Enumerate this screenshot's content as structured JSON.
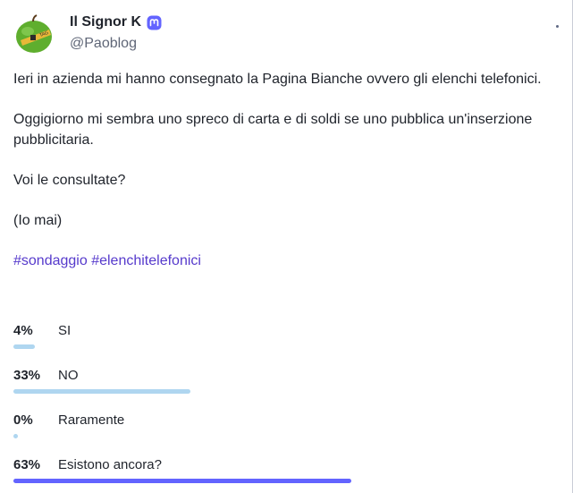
{
  "author": {
    "display_name": "Il Signor K",
    "handle": "@Paoblog",
    "avatar_icon": "green-apple-avatar",
    "badge_icon": "mastodon-icon"
  },
  "post": {
    "paragraphs": [
      "Ieri in azienda mi hanno consegnato la Pagina Bianche ovvero gli elenchi telefonici.",
      "Oggigiorno mi sembra uno spreco di carta e di soldi se uno pubblica un'inserzione pubblicitaria.",
      "Voi le consultate?",
      "(Io mai)"
    ],
    "hashtags": [
      "#sondaggio",
      "#elenchitelefonici"
    ]
  },
  "poll": {
    "options": [
      {
        "percent_label": "4%",
        "label": "SI",
        "percent": 4,
        "leading": false
      },
      {
        "percent_label": "33%",
        "label": "NO",
        "percent": 33,
        "leading": false
      },
      {
        "percent_label": "0%",
        "label": "Raramente",
        "percent": 0,
        "leading": false
      },
      {
        "percent_label": "63%",
        "label": "Esistono ancora?",
        "percent": 63,
        "leading": true
      }
    ]
  },
  "colors": {
    "accent": "#563acc",
    "bar": "#afd6f0",
    "bar_leading": "#6364ff"
  }
}
